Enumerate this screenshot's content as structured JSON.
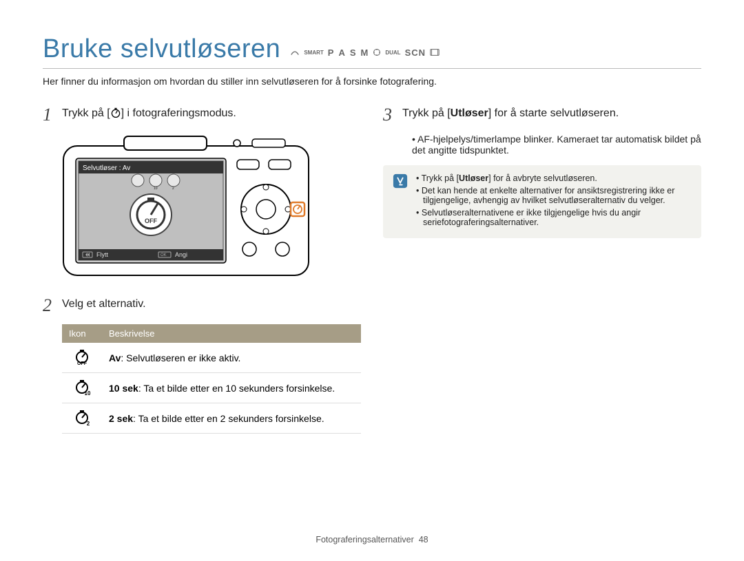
{
  "title": "Bruke selvutløseren",
  "modes": {
    "smart": "SMART",
    "p": "P",
    "a": "A",
    "s": "S",
    "m": "M",
    "dual": "DUAL",
    "scn": "SCN"
  },
  "intro": "Her finner du informasjon om hvordan du stiller inn selvutløseren for å forsinke fotografering.",
  "step1": {
    "num": "1",
    "pre": "Trykk på [",
    "post": "] i fotograferingsmodus."
  },
  "camera": {
    "header": "Selvutløser : Av",
    "left_label": "Flytt",
    "right_label": "Angi",
    "center_label": "OFF"
  },
  "step2": {
    "num": "2",
    "text": "Velg et alternativ."
  },
  "table": {
    "h1": "Ikon",
    "h2": "Beskrivelse",
    "rows": [
      {
        "icon": "OFF",
        "label": "Av",
        "desc": ": Selvutløseren er ikke aktiv."
      },
      {
        "icon": "10",
        "label": "10 sek",
        "desc": ": Ta et bilde etter en 10 sekunders forsinkelse."
      },
      {
        "icon": "2",
        "label": "2 sek",
        "desc": ": Ta et bilde etter en 2 sekunders forsinkelse."
      }
    ]
  },
  "step3": {
    "num": "3",
    "pre": "Trykk på [",
    "mid": "Utløser",
    "post": "] for å starte selvutløseren."
  },
  "step3_sub": "AF-hjelpelys/timerlampe blinker. Kameraet tar automatisk bildet på det angitte tidspunktet.",
  "info": {
    "line1_pre": "Trykk på [",
    "line1_mid": "Utløser",
    "line1_post": "] for å avbryte selvutløseren.",
    "line2": "Det kan hende at enkelte alternativer for ansiktsregistrering ikke er tilgjengelige, avhengig av hvilket selvutløseralternativ du velger.",
    "line3": "Selvutløseralternativene er ikke tilgjengelige hvis du angir seriefotograferingsalternativer."
  },
  "footer": {
    "section": "Fotograferingsalternativer",
    "page": "48"
  }
}
